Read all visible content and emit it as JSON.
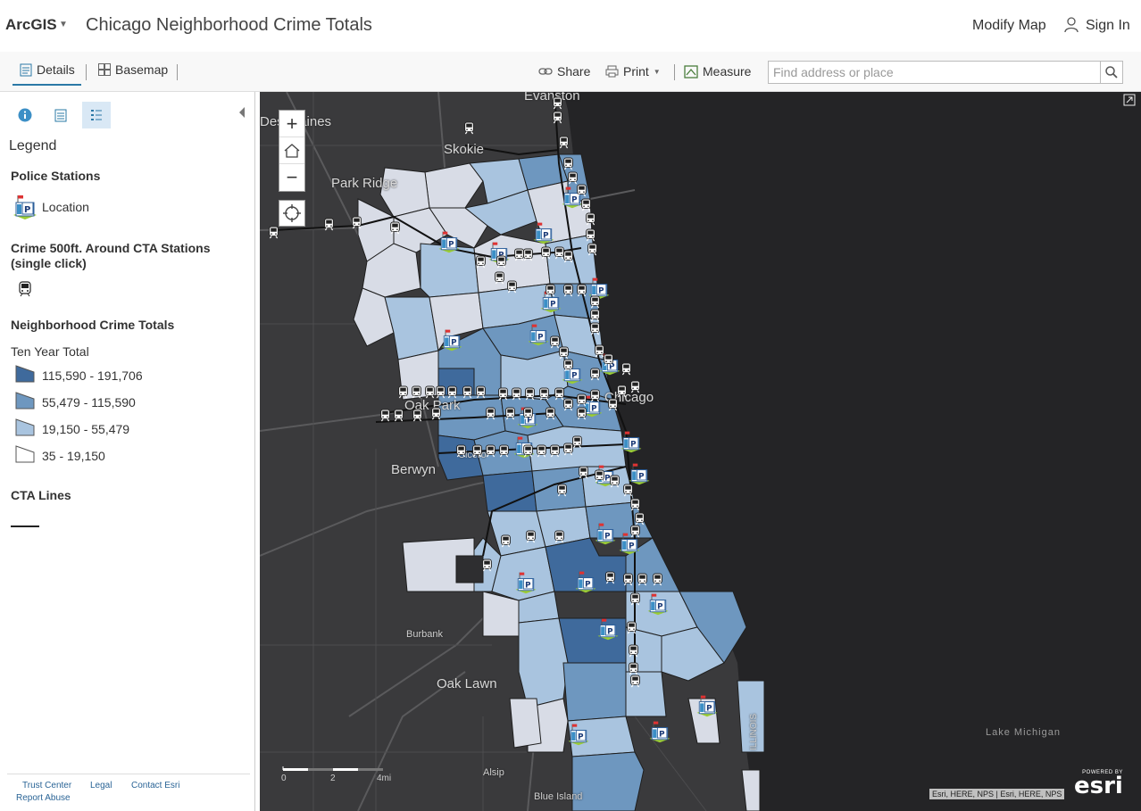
{
  "header": {
    "brand": "ArcGIS",
    "title": "Chicago Neighborhood Crime Totals",
    "modify_map": "Modify Map",
    "sign_in": "Sign In"
  },
  "toolbar": {
    "details": "Details",
    "basemap": "Basemap",
    "share": "Share",
    "print": "Print",
    "measure": "Measure",
    "search_placeholder": "Find address or place"
  },
  "panel": {
    "legend_title": "Legend",
    "police_heading": "Police Stations",
    "police_item": "Location",
    "cta_heading": "Crime 500ft. Around CTA Stations (single click)",
    "crime_heading": "Neighborhood Crime Totals",
    "crime_sub": "Ten Year Total",
    "classes": [
      {
        "label": "115,590 - 191,706",
        "color": "#3f6a9c"
      },
      {
        "label": "55,479 - 115,590",
        "color": "#6e97bf"
      },
      {
        "label": "19,150 - 55,479",
        "color": "#a9c4df"
      },
      {
        "label": "35 - 19,150",
        "color": "#d8dce6"
      }
    ],
    "lines_heading": "CTA Lines",
    "footer": {
      "trust": "Trust Center",
      "legal": "Legal",
      "contact": "Contact Esri",
      "abuse": "Report Abuse"
    }
  },
  "map": {
    "labels": {
      "evanston": "Evanston",
      "des_plaines": "Des Plaines",
      "skokie": "Skokie",
      "park_ridge": "Park Ridge",
      "oak_park": "Oak Park",
      "chicago": "Chicago",
      "cicero": "Cicero",
      "berwyn": "Berwyn",
      "burbank": "Burbank",
      "oak_lawn": "Oak Lawn",
      "alsip": "Alsip",
      "blue_island": "Blue Island",
      "illinois": "ILLINOIS",
      "lake_michigan": "Lake Michigan"
    },
    "scale": {
      "zero": "0",
      "two": "2",
      "four": "4mi"
    },
    "attribution": "Esri, HERE, NPS | Esri, HERE, NPS",
    "powered_by": "POWERED BY",
    "esri": "esri"
  }
}
